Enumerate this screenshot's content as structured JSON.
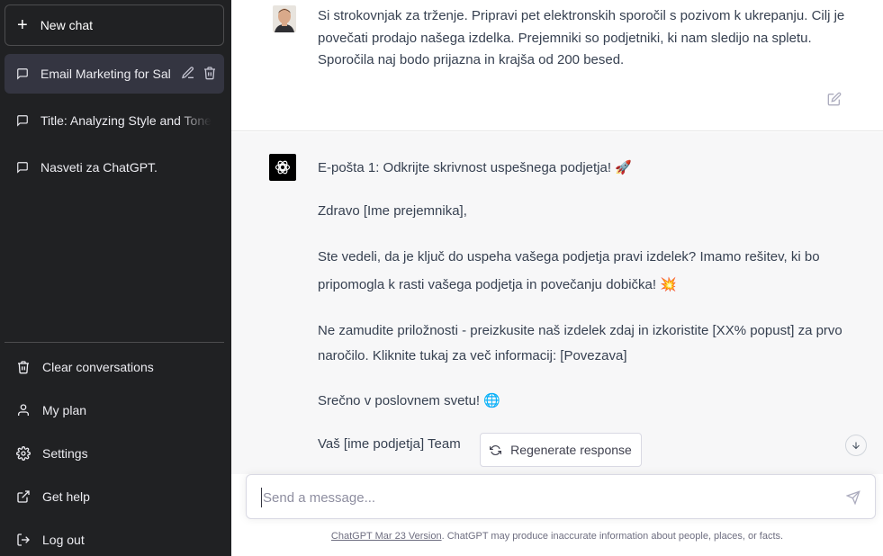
{
  "sidebar": {
    "new_chat_label": "New chat",
    "conversations": [
      {
        "label": "Email Marketing for Sal"
      },
      {
        "label": "Title: Analyzing Style and Tone"
      },
      {
        "label": "Nasveti za ChatGPT."
      }
    ],
    "menu": {
      "clear": "Clear conversations",
      "plan": "My plan",
      "settings": "Settings",
      "help": "Get help",
      "logout": "Log out"
    }
  },
  "user_message": {
    "text": "Si strokovnjak za trženje. Pripravi pet elektronskih sporočil s pozivom k ukrepanju. Cilj je povečati prodajo našega izdelka. Prejemniki so podjetniki, ki nam sledijo na spletu. Sporočila naj bodo prijazna in krajša od 200 besed."
  },
  "assistant_message": {
    "p1": "E-pošta 1: Odkrijte skrivnost uspešnega podjetja!",
    "p1_emoji": "🚀",
    "p2": "Zdravo [Ime prejemnika],",
    "p3": "Ste vedeli, da je ključ do uspeha vašega podjetja pravi izdelek? Imamo rešitev, ki bo pripomogla k rasti vašega podjetja in povečanju dobička!",
    "p3_emoji": "💥",
    "p4": "Ne zamudite priložnosti - preizkusite naš izdelek zdaj in izkoristite [XX% popust] za prvo naročilo. Kliknite tukaj za več informacij: [Povezava]",
    "p5": "Srečno v poslovnem svetu!",
    "p5_emoji": "🌐",
    "p6": "Vaš [ime podjetja] Team"
  },
  "regenerate_label": "Regenerate response",
  "input": {
    "placeholder": "Send a message..."
  },
  "footer": {
    "link": "ChatGPT Mar 23 Version",
    "text": ". ChatGPT may produce inaccurate information about people, places, or facts."
  },
  "colors": {
    "sidebar_bg": "#202123",
    "active_conv_bg": "#343541",
    "bot_bg": "#f7f7f8"
  }
}
